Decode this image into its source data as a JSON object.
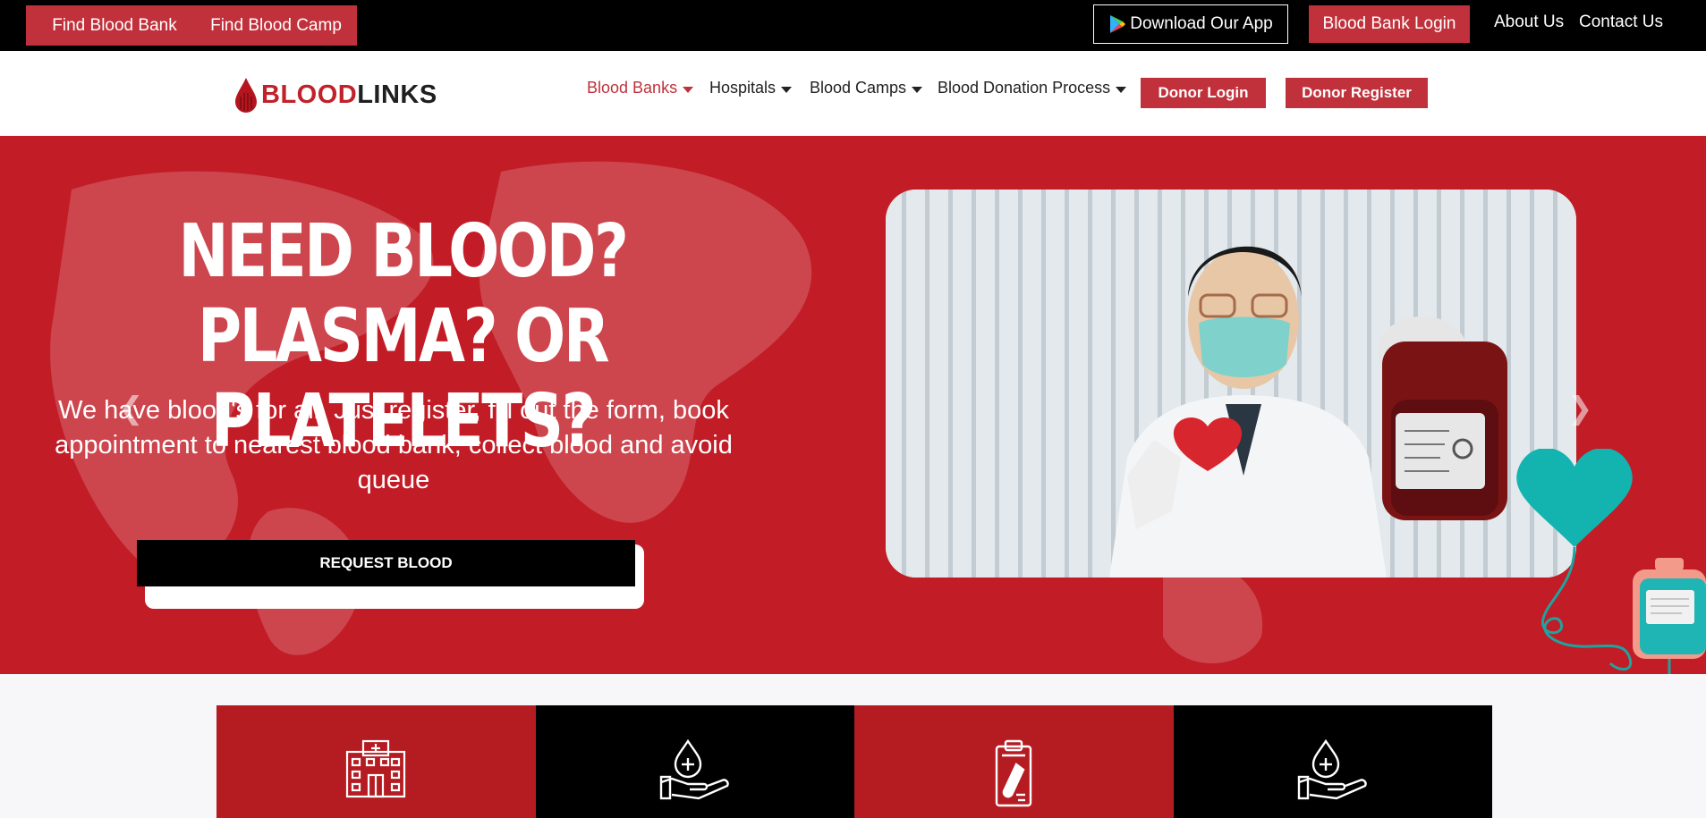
{
  "topbar": {
    "find_blood_bank": "Find Blood Bank",
    "find_blood_camp": "Find Blood Camp",
    "download_app": "Download Our App",
    "blood_bank_login": "Blood Bank Login",
    "about_us": "About Us",
    "contact_us": "Contact Us"
  },
  "logo": {
    "part1": "BLOOD",
    "part2": "LINKS"
  },
  "nav": {
    "items": [
      {
        "label": "Blood Banks",
        "active": true
      },
      {
        "label": "Hospitals"
      },
      {
        "label": "Blood Camps"
      },
      {
        "label": "Blood Donation Process"
      }
    ],
    "donor_login": "Donor Login",
    "donor_register": "Donor Register"
  },
  "hero": {
    "title_line1": "NEED BLOOD?",
    "title_line2": "PLASMA? OR PLATELETS?",
    "subtitle": "We have blood's for all. Just register, fill out the form, book appointment to nearest blood bank, collect blood and avoid queue",
    "request_button": "REQUEST BLOOD",
    "prev_icon": "chevron-left-icon",
    "next_icon": "chevron-right-icon"
  },
  "features": [
    {
      "icon": "hospital-icon",
      "color": "#b51c22"
    },
    {
      "icon": "blood-drop-hand-icon",
      "color": "#000000"
    },
    {
      "icon": "clipboard-test-tube-icon",
      "color": "#b51c22"
    },
    {
      "icon": "blood-drop-hand-icon",
      "color": "#000000"
    }
  ],
  "colors": {
    "brand_red": "#c0313b",
    "hero_red": "#c21c26",
    "teal": "#1fb5b5"
  }
}
